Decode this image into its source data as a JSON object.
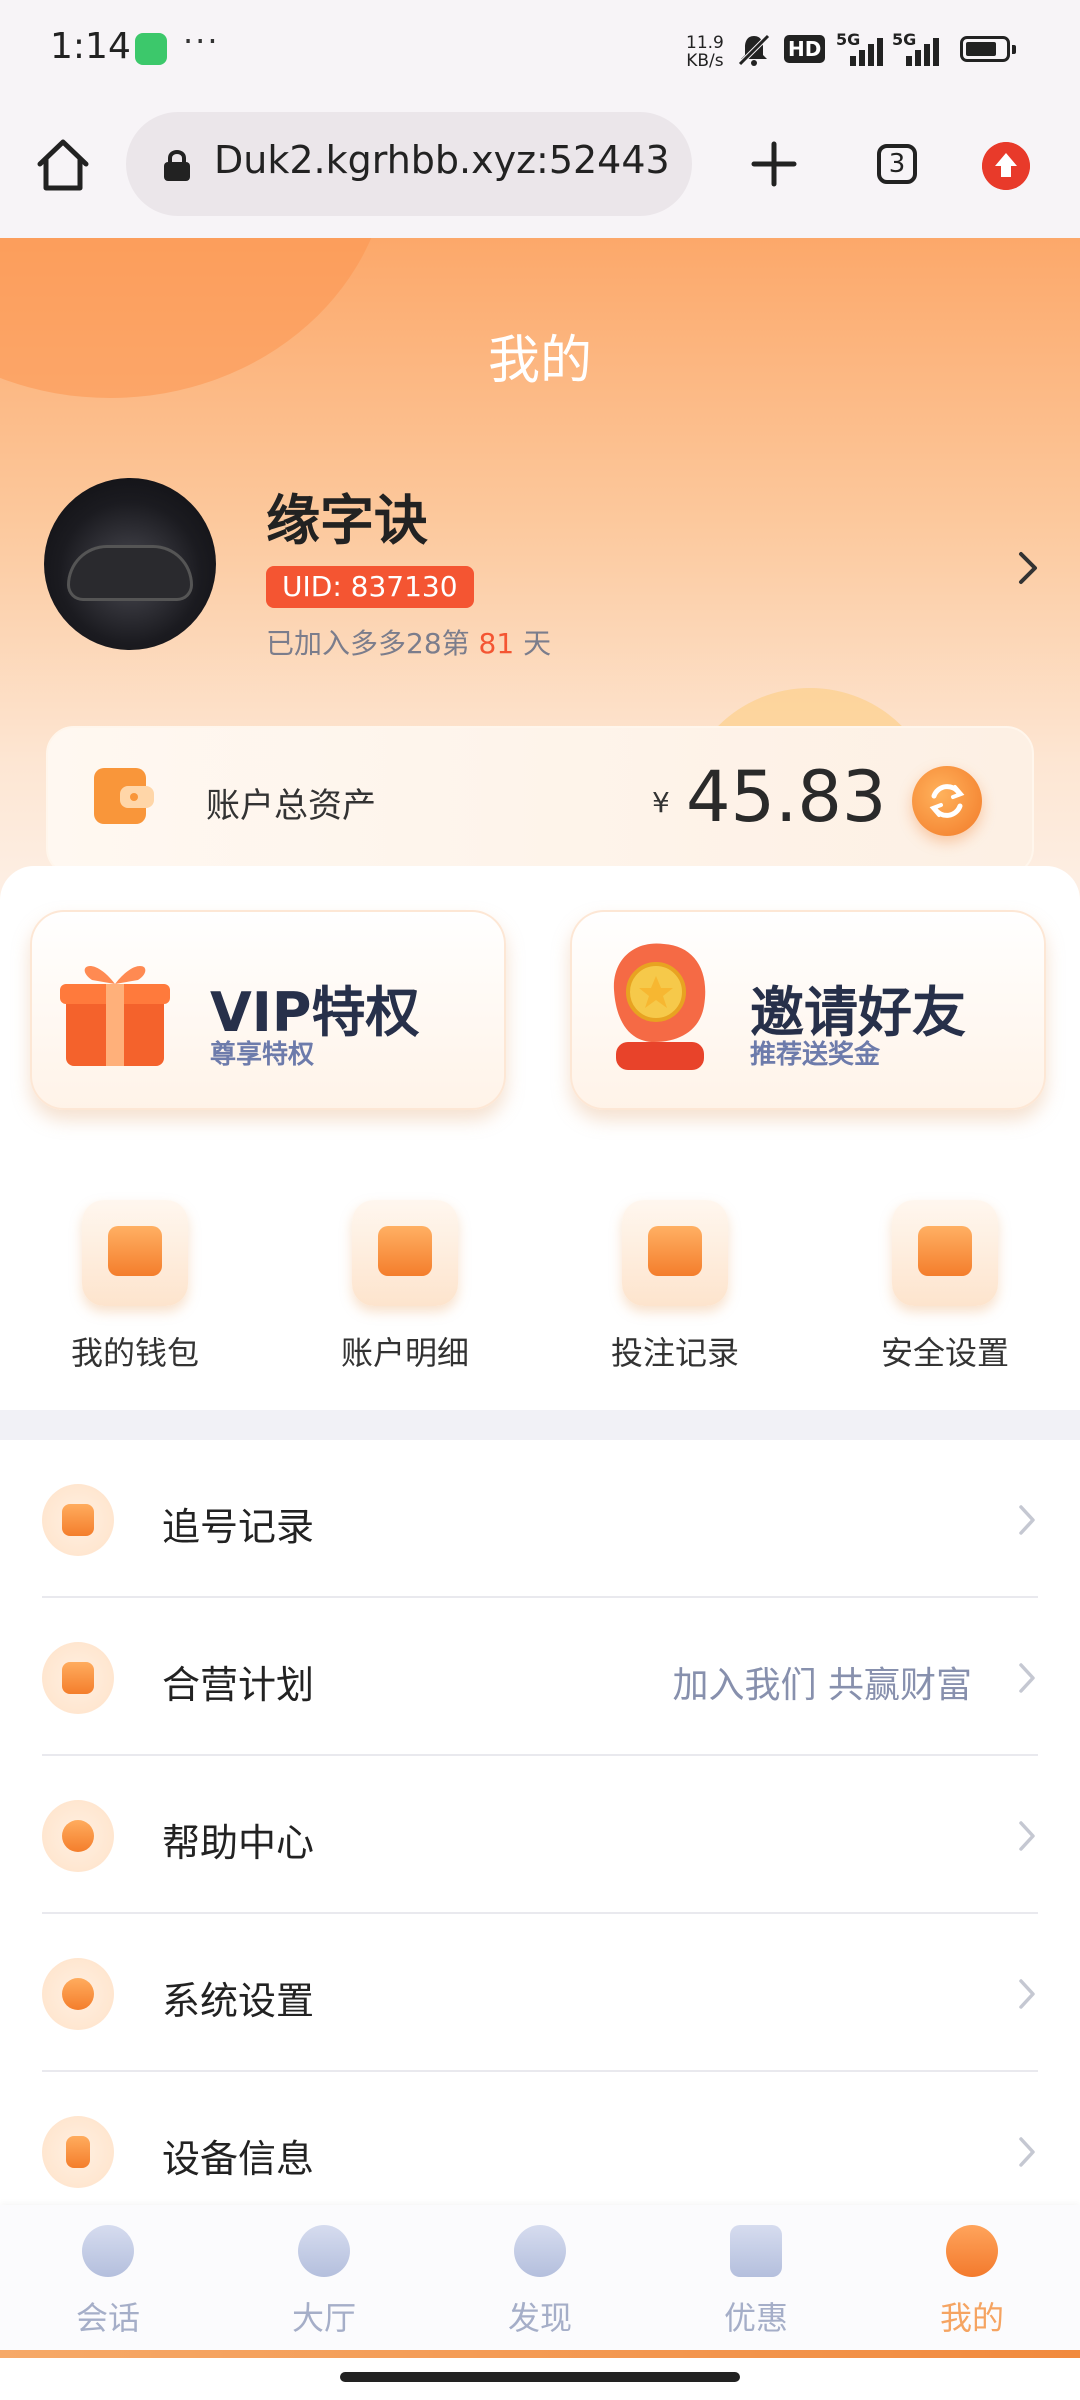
{
  "status_bar": {
    "time": "1:14",
    "more": "···",
    "net_speed_value": "11.9",
    "net_speed_unit": "KB/s",
    "hd": "HD",
    "signal_1": "5G",
    "signal_2": "5G"
  },
  "browser": {
    "url": "Duk2.kgrhbb.xyz:52443",
    "tab_count": "3"
  },
  "header": {
    "title": "我的",
    "username": "缘字诀",
    "uid": "UID: 837130",
    "joined_prefix": "已加入多多28第 ",
    "joined_days": "81",
    "joined_suffix": " 天"
  },
  "asset": {
    "label": "账户总资产",
    "currency": "¥",
    "value": "45.83"
  },
  "promos": {
    "vip_title": "VIP特权",
    "vip_sub": "尊享特权",
    "invite_title": "邀请好友",
    "invite_sub": "推荐送奖金"
  },
  "quick_menu": [
    {
      "label": "我的钱包"
    },
    {
      "label": "账户明细"
    },
    {
      "label": "投注记录"
    },
    {
      "label": "安全设置"
    }
  ],
  "menu_list": [
    {
      "label": "追号记录",
      "note": ""
    },
    {
      "label": "合营计划",
      "note": "加入我们 共赢财富"
    },
    {
      "label": "帮助中心",
      "note": ""
    },
    {
      "label": "系统设置",
      "note": ""
    },
    {
      "label": "设备信息",
      "note": ""
    }
  ],
  "tab_bar": [
    {
      "label": "会话"
    },
    {
      "label": "大厅"
    },
    {
      "label": "发现"
    },
    {
      "label": "优惠"
    },
    {
      "label": "我的"
    }
  ],
  "colors": {
    "accent": "#f47e2c",
    "uid_badge": "#f45532",
    "active_tab": "#f5a462",
    "inactive_tab": "#a5aec8"
  }
}
